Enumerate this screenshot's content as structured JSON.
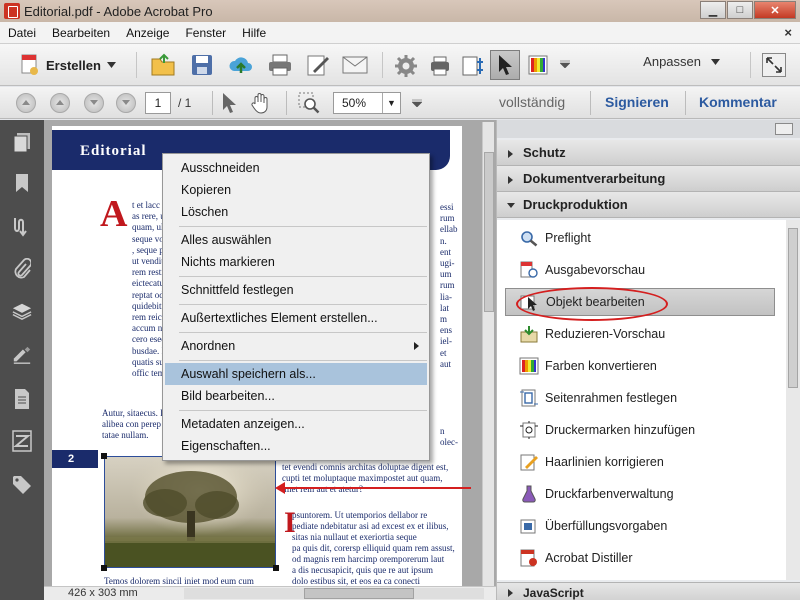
{
  "window": {
    "title": "Editorial.pdf - Adobe Acrobat Pro",
    "minimize": "▁",
    "maximize": "□",
    "close": "✕"
  },
  "menu": {
    "items": [
      "Datei",
      "Bearbeiten",
      "Anzeige",
      "Fenster",
      "Hilfe"
    ],
    "close_doc": "×"
  },
  "toolbar": {
    "create_label": "Erstellen",
    "anpassen_label": "Anpassen",
    "icons": [
      "open-folder-icon",
      "save-icon",
      "cloud-upload-icon",
      "print-icon",
      "edit-sign-icon",
      "email-icon",
      "gear-icon",
      "print-setup-icon",
      "adjust-icon",
      "select-tool-icon",
      "color-swatch-icon"
    ]
  },
  "nav": {
    "page_current": "1",
    "page_total": "/ 1",
    "zoom": "50%",
    "vollstaendig": "vollständig",
    "signieren": "Signieren",
    "kommentar": "Kommentar"
  },
  "document": {
    "header_title": "Editorial",
    "drop_cap": "A",
    "page_number": "2",
    "dimensions": "426 x 303 mm",
    "lines_left": [
      "t et lacc",
      "as rere, u",
      "quam, ulparum",
      "seque volorepe",
      ", seque plam",
      "ut venditas duci",
      "rem restibu sam",
      "eictecatus aut a",
      "reptat od mag",
      "quidebitius eum",
      "rem reicienis exc",
      "accum num qu",
      "cero esequam f",
      "busdae. Nam, cu",
      "quatis suntio",
      "offic tem quis a"
    ],
    "lines_left2": [
      "Autur, sitaecus. Ib",
      "alibea con perep",
      "tatae nullam."
    ],
    "lines_right": [
      "essi",
      "rum",
      "ellab",
      "n.",
      "ent",
      "ugi-",
      "um",
      "rum",
      "lia-",
      "lat",
      "m",
      "ens",
      "iel-",
      "et",
      "aut"
    ],
    "lines_below_a": [
      "n",
      "olec-"
    ],
    "lines_below": [
      "tet evendi comnis architas doluptae digent est,",
      "cupti tet moluptaque maximpostet aut quam,",
      "imet rem aut et atetur?"
    ],
    "drop_cap2": "I",
    "lines_p2": [
      "psuntorem. Ut utemporios dellabor re",
      "pediate ndebitatur asi ad excest ex et ilibus,",
      "sitas nia nullaut et exeriortia seque",
      "pa quis dit, corersp elliquid quam rem assust,",
      "od magnis rem harcimp oremporerum laut",
      "a dis necusapicit, quis que re aut ipsum",
      "dolo estibus sit, et eos ea ca conecti"
    ],
    "caption": "Temos dolorem sincil iniet mod eum cum"
  },
  "context_menu": [
    {
      "label": "Ausschneiden"
    },
    {
      "label": "Kopieren"
    },
    {
      "label": "Löschen"
    },
    {
      "label": "Alles auswählen"
    },
    {
      "label": "Nichts markieren"
    },
    {
      "label": "Schnittfeld festlegen"
    },
    {
      "label": "Außertextliches Element erstellen..."
    },
    {
      "label": "Anordnen"
    },
    {
      "label": "Auswahl speichern als..."
    },
    {
      "label": "Bild bearbeiten..."
    },
    {
      "label": "Metadaten anzeigen..."
    },
    {
      "label": "Eigenschaften..."
    }
  ],
  "panel": {
    "sections": [
      "Schutz",
      "Dokumentverarbeitung",
      "Druckproduktion"
    ],
    "tools": [
      {
        "label": "Preflight",
        "icon": "preflight-icon"
      },
      {
        "label": "Ausgabevorschau",
        "icon": "output-preview-icon"
      },
      {
        "label": "Objekt bearbeiten",
        "icon": "edit-object-icon"
      },
      {
        "label": "Reduzieren-Vorschau",
        "icon": "flatten-preview-icon"
      },
      {
        "label": "Farben konvertieren",
        "icon": "convert-colors-icon"
      },
      {
        "label": "Seitenrahmen festlegen",
        "icon": "page-boxes-icon"
      },
      {
        "label": "Druckermarken hinzufügen",
        "icon": "printer-marks-icon"
      },
      {
        "label": "Haarlinien korrigieren",
        "icon": "fix-hairlines-icon"
      },
      {
        "label": "Druckfarbenverwaltung",
        "icon": "ink-manager-icon"
      },
      {
        "label": "Überfüllungsvorgaben",
        "icon": "trap-presets-icon"
      },
      {
        "label": "Acrobat Distiller",
        "icon": "distiller-icon"
      }
    ],
    "javascript_section": "JavaScript"
  },
  "colors": {
    "accent_blue": "#1a2b6b",
    "annotation_red": "#d41f1f",
    "menu_highlight": "#a9c3dc"
  }
}
